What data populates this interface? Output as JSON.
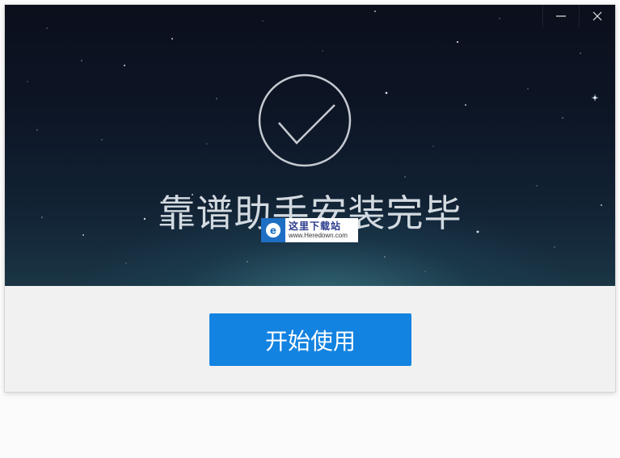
{
  "window": {
    "title": "",
    "controls": {
      "minimize_icon": "minimize-icon",
      "close_icon": "close-icon"
    }
  },
  "banner": {
    "status_icon": "checkmark-circle-icon",
    "headline": "靠谱助手安装完毕"
  },
  "watermark": {
    "logo_icon": "heredown-logo-icon",
    "name": "这里下载站",
    "url": "www.Heredown.com"
  },
  "footer": {
    "start_button_label": "开始使用"
  },
  "colors": {
    "accent": "#1383e1",
    "banner_dark": "#0b0f1c",
    "footer_bg": "#f1f1f1",
    "headline": "#e8eef3"
  }
}
